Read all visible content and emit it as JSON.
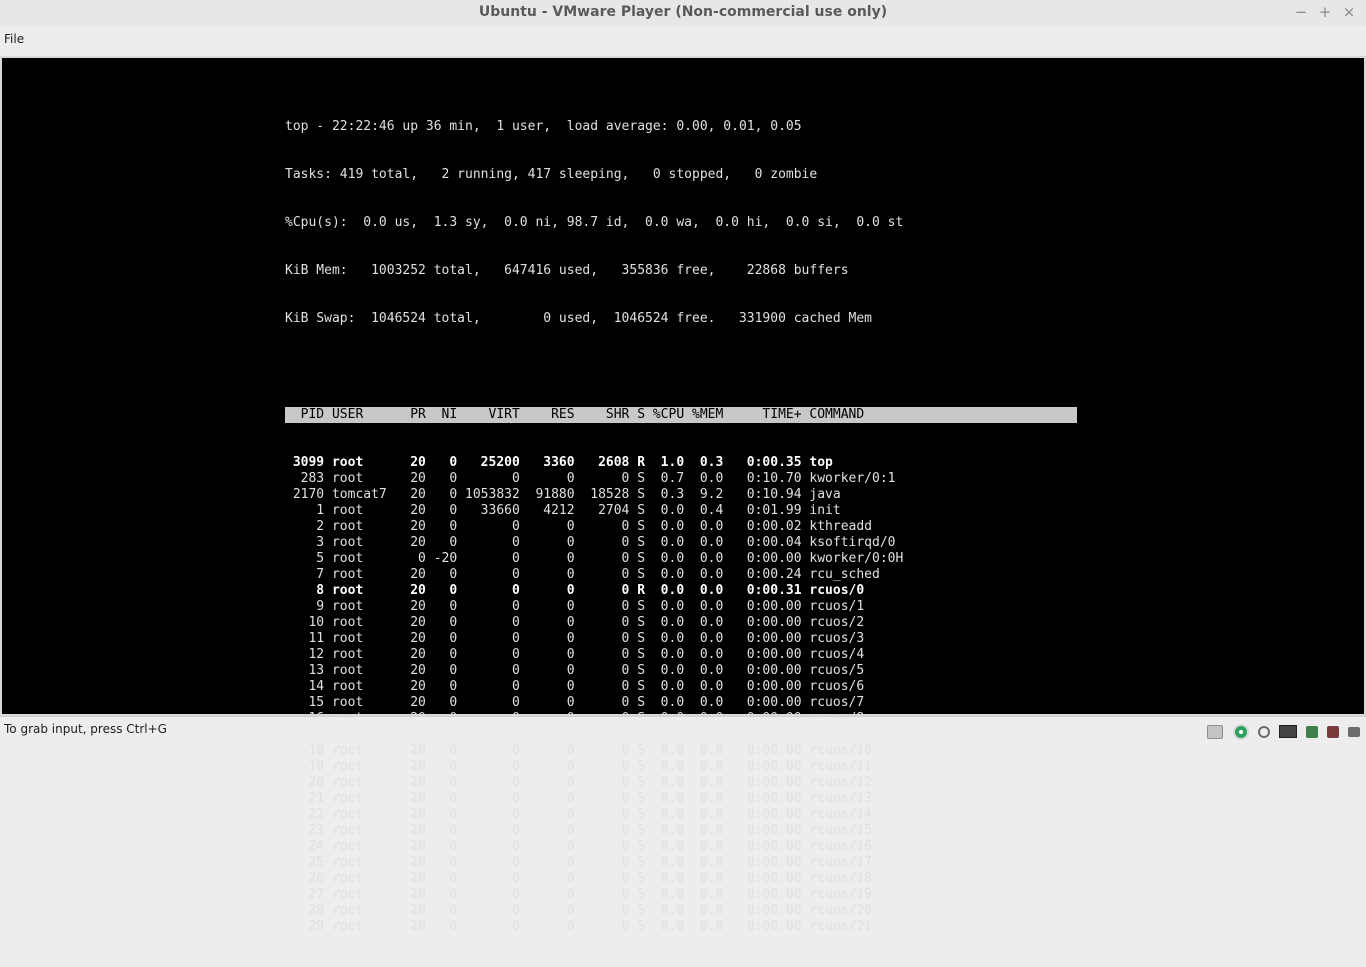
{
  "window": {
    "title": "Ubuntu - VMware Player (Non-commercial use only)",
    "minimize": "−",
    "maximize": "+",
    "close": "×"
  },
  "menu": {
    "file": "File"
  },
  "terminal": {
    "summary": [
      "top - 22:22:46 up 36 min,  1 user,  load average: 0.00, 0.01, 0.05",
      "Tasks: 419 total,   2 running, 417 sleeping,   0 stopped,   0 zombie",
      "%Cpu(s):  0.0 us,  1.3 sy,  0.0 ni, 98.7 id,  0.0 wa,  0.0 hi,  0.0 si,  0.0 st",
      "KiB Mem:   1003252 total,   647416 used,   355836 free,    22868 buffers",
      "KiB Swap:  1046524 total,        0 used,  1046524 free.   331900 cached Mem"
    ],
    "header": "  PID USER      PR  NI    VIRT    RES    SHR S %CPU %MEM     TIME+ COMMAND",
    "processes": [
      {
        "text": " 3099 root      20   0   25200   3360   2608 R  1.0  0.3   0:00.35 top",
        "bold": true
      },
      {
        "text": "  283 root      20   0       0      0      0 S  0.7  0.0   0:10.70 kworker/0:1",
        "bold": false
      },
      {
        "text": " 2170 tomcat7   20   0 1053832  91880  18528 S  0.3  9.2   0:10.94 java",
        "bold": false
      },
      {
        "text": "    1 root      20   0   33660   4212   2704 S  0.0  0.4   0:01.99 init",
        "bold": false
      },
      {
        "text": "    2 root      20   0       0      0      0 S  0.0  0.0   0:00.02 kthreadd",
        "bold": false
      },
      {
        "text": "    3 root      20   0       0      0      0 S  0.0  0.0   0:00.04 ksoftirqd/0",
        "bold": false
      },
      {
        "text": "    5 root       0 -20       0      0      0 S  0.0  0.0   0:00.00 kworker/0:0H",
        "bold": false
      },
      {
        "text": "    7 root      20   0       0      0      0 S  0.0  0.0   0:00.24 rcu_sched",
        "bold": false
      },
      {
        "text": "    8 root      20   0       0      0      0 R  0.0  0.0   0:00.31 rcuos/0",
        "bold": true
      },
      {
        "text": "    9 root      20   0       0      0      0 S  0.0  0.0   0:00.00 rcuos/1",
        "bold": false
      },
      {
        "text": "   10 root      20   0       0      0      0 S  0.0  0.0   0:00.00 rcuos/2",
        "bold": false
      },
      {
        "text": "   11 root      20   0       0      0      0 S  0.0  0.0   0:00.00 rcuos/3",
        "bold": false
      },
      {
        "text": "   12 root      20   0       0      0      0 S  0.0  0.0   0:00.00 rcuos/4",
        "bold": false
      },
      {
        "text": "   13 root      20   0       0      0      0 S  0.0  0.0   0:00.00 rcuos/5",
        "bold": false
      },
      {
        "text": "   14 root      20   0       0      0      0 S  0.0  0.0   0:00.00 rcuos/6",
        "bold": false
      },
      {
        "text": "   15 root      20   0       0      0      0 S  0.0  0.0   0:00.00 rcuos/7",
        "bold": false
      },
      {
        "text": "   16 root      20   0       0      0      0 S  0.0  0.0   0:00.00 rcuos/8",
        "bold": false
      },
      {
        "text": "   17 root      20   0       0      0      0 S  0.0  0.0   0:00.00 rcuos/9",
        "bold": false
      },
      {
        "text": "   18 root      20   0       0      0      0 S  0.0  0.0   0:00.00 rcuos/10",
        "bold": false
      },
      {
        "text": "   19 root      20   0       0      0      0 S  0.0  0.0   0:00.00 rcuos/11",
        "bold": false
      },
      {
        "text": "   20 root      20   0       0      0      0 S  0.0  0.0   0:00.00 rcuos/12",
        "bold": false
      },
      {
        "text": "   21 root      20   0       0      0      0 S  0.0  0.0   0:00.00 rcuos/13",
        "bold": false
      },
      {
        "text": "   22 root      20   0       0      0      0 S  0.0  0.0   0:00.00 rcuos/14",
        "bold": false
      },
      {
        "text": "   23 root      20   0       0      0      0 S  0.0  0.0   0:00.00 rcuos/15",
        "bold": false
      },
      {
        "text": "   24 root      20   0       0      0      0 S  0.0  0.0   0:00.00 rcuos/16",
        "bold": false
      },
      {
        "text": "   25 root      20   0       0      0      0 S  0.0  0.0   0:00.00 rcuos/17",
        "bold": false
      },
      {
        "text": "   26 root      20   0       0      0      0 S  0.0  0.0   0:00.00 rcuos/18",
        "bold": false
      },
      {
        "text": "   27 root      20   0       0      0      0 S  0.0  0.0   0:00.00 rcuos/19",
        "bold": false
      },
      {
        "text": "   28 root      20   0       0      0      0 S  0.0  0.0   0:00.00 rcuos/20",
        "bold": false
      },
      {
        "text": "   29 root      20   0       0      0      0 S  0.0  0.0   0:00.00 rcuos/21",
        "bold": false
      }
    ]
  },
  "status": {
    "text": "To grab input, press Ctrl+G",
    "devices": [
      "hard-disk-icon",
      "cd-dvd-icon",
      "search-device-icon",
      "network-adapter-icon",
      "usb-device-icon",
      "usb-device-icon",
      "more-devices-icon"
    ]
  }
}
